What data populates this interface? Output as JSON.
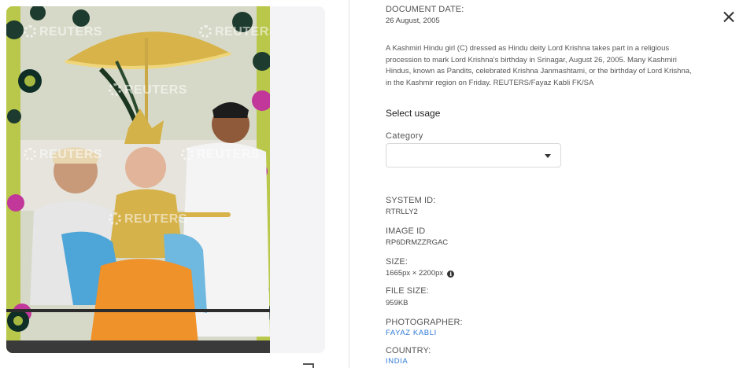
{
  "photo": {
    "alt_subject": "",
    "watermark_text": "REUTERS"
  },
  "detail": {
    "document_date_label": "DOCUMENT DATE:",
    "document_date": "26 August, 2005",
    "caption": "A Kashmiri Hindu girl (C) dressed as Hindu deity Lord Krishna takes part in a religious procession to mark Lord Krishna's birthday in Srinagar, August 26, 2005. Many Kashmiri Hindus, known as Pandits, celebrated Krishna Janmashtami, or the birthday of Lord Krishna, in the Kashmir region on Friday. REUTERS/Fayaz Kabli FK/SA",
    "select_usage": "Select usage",
    "category_label": "Category",
    "category_value": "",
    "system_id_label": "SYSTEM ID:",
    "system_id": "RTRLLY2",
    "image_id_label": "IMAGE ID",
    "image_id": "RP6DRMZZRGAC",
    "size_label": "SIZE:",
    "size": "1665px × 2200px",
    "file_size_label": "FILE SIZE:",
    "file_size": "959KB",
    "photographer_label": "PHOTOGRAPHER:",
    "photographer": "FAYAZ KABLI",
    "country_label": "COUNTRY:",
    "country": "INDIA"
  },
  "icons": {
    "close": "close-icon",
    "dropdown": "chevron-down-icon",
    "info": "info-icon",
    "expand": "expand-icon"
  },
  "colors": {
    "link": "#2f7ad6",
    "panel_bg": "#f4f4f7"
  }
}
